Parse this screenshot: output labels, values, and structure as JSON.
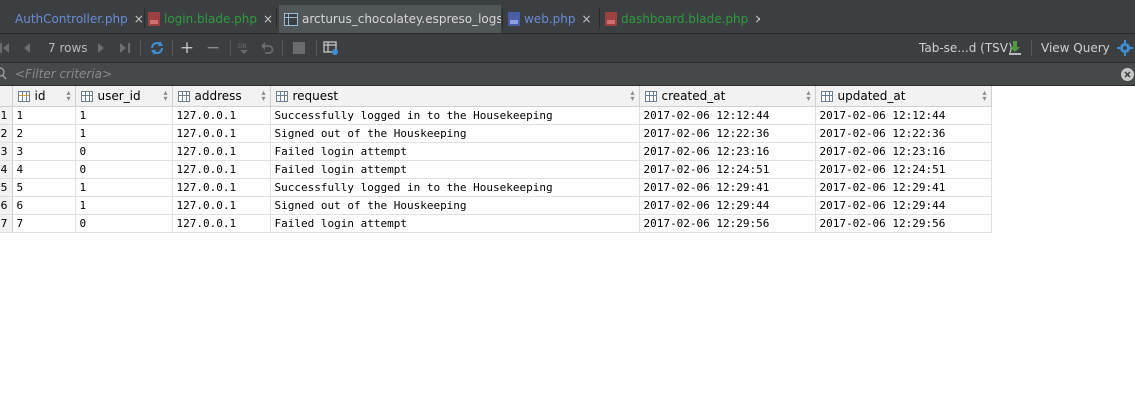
{
  "tabs": [
    {
      "label": "AuthController.php",
      "icon": "php-file-icon",
      "color": "#6b8cd6",
      "active": false
    },
    {
      "label": "login.blade.php",
      "icon": "blade-file-icon",
      "color": "#2f9c3c",
      "active": false
    },
    {
      "label": "arcturus_chocolatey.espreso_logs",
      "icon": "table-icon",
      "color": "#d8d8d8",
      "active": true
    },
    {
      "label": "web.php",
      "icon": "php-file-icon",
      "color": "#6b8cd6",
      "active": false
    },
    {
      "label": "dashboard.blade.php",
      "icon": "blade-file-icon",
      "color": "#2f9c3c",
      "active": false
    }
  ],
  "tab_close_glyph": "×",
  "toolbar": {
    "rows_label": "7 rows",
    "export_format": "Tab-se...d (TSV)",
    "view_query": "View Query"
  },
  "filter": {
    "placeholder": "<Filter criteria>",
    "value": ""
  },
  "grid": {
    "columns": [
      "id",
      "user_id",
      "address",
      "request",
      "created_at",
      "updated_at"
    ],
    "rows": [
      {
        "num": "1",
        "cells": [
          "1",
          "1",
          "127.0.0.1",
          "Successfully logged in to the Housekeeping",
          "2017-02-06 12:12:44",
          "2017-02-06 12:12:44"
        ]
      },
      {
        "num": "2",
        "cells": [
          "2",
          "1",
          "127.0.0.1",
          "Signed out of the Houskeeping",
          "2017-02-06 12:22:36",
          "2017-02-06 12:22:36"
        ]
      },
      {
        "num": "3",
        "cells": [
          "3",
          "0",
          "127.0.0.1",
          "Failed login attempt",
          "2017-02-06 12:23:16",
          "2017-02-06 12:23:16"
        ]
      },
      {
        "num": "4",
        "cells": [
          "4",
          "0",
          "127.0.0.1",
          "Failed login attempt",
          "2017-02-06 12:24:51",
          "2017-02-06 12:24:51"
        ]
      },
      {
        "num": "5",
        "cells": [
          "5",
          "1",
          "127.0.0.1",
          "Successfully logged in to the Housekeeping",
          "2017-02-06 12:29:41",
          "2017-02-06 12:29:41"
        ]
      },
      {
        "num": "6",
        "cells": [
          "6",
          "1",
          "127.0.0.1",
          "Signed out of the Houskeeping",
          "2017-02-06 12:29:44",
          "2017-02-06 12:29:44"
        ]
      },
      {
        "num": "7",
        "cells": [
          "7",
          "0",
          "127.0.0.1",
          "Failed login attempt",
          "2017-02-06 12:29:56",
          "2017-02-06 12:29:56"
        ]
      }
    ]
  },
  "colors": {
    "dark_bg": "#3c3f41",
    "accent_blue": "#3d8fd6",
    "export_green": "#4e9a3c"
  }
}
